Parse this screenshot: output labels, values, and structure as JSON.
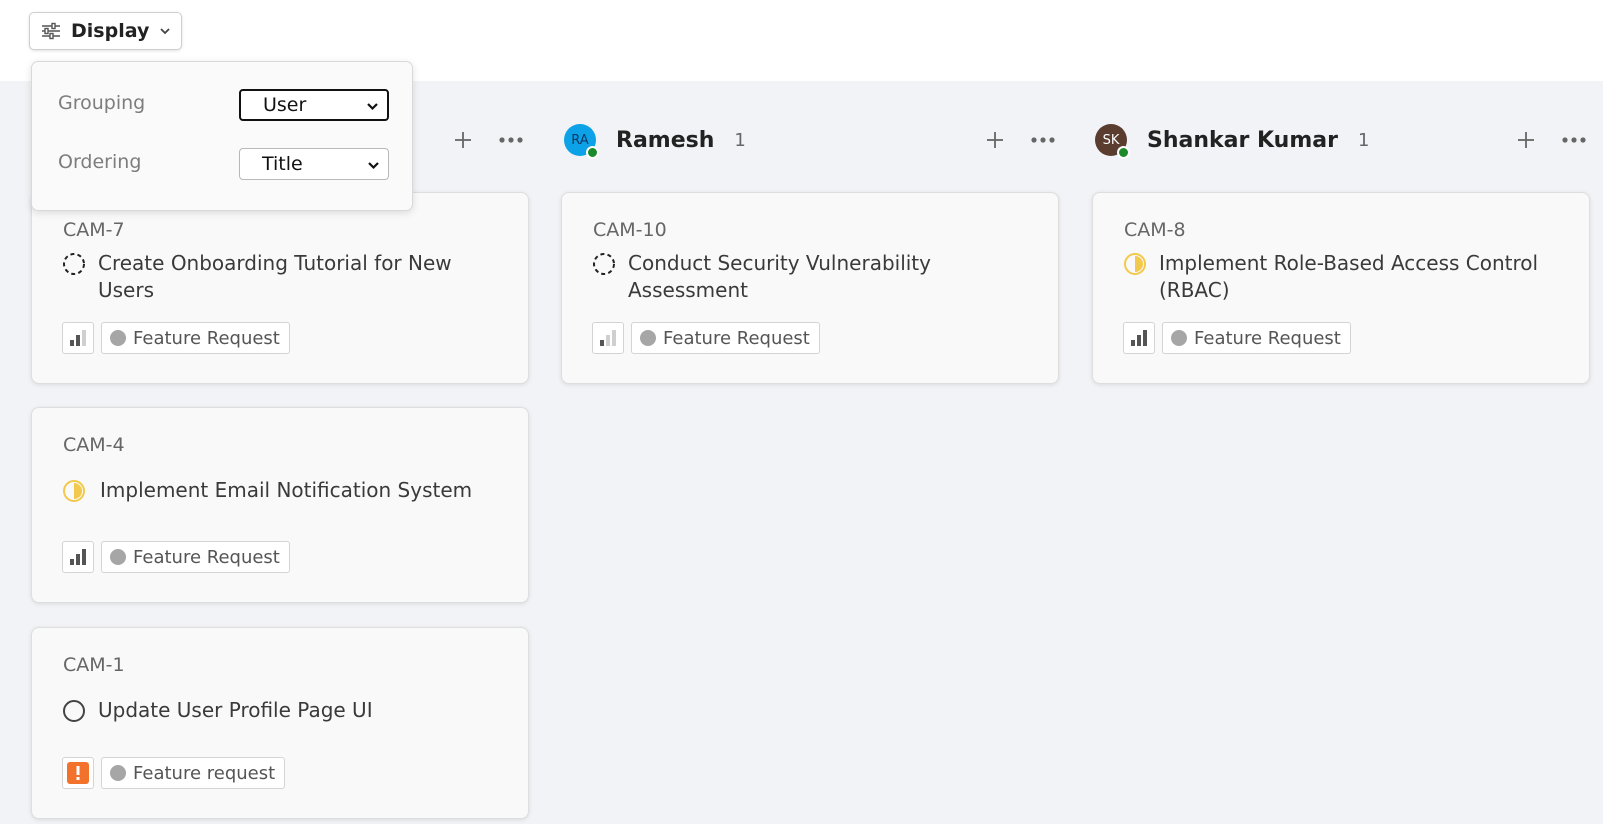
{
  "display": {
    "label": "Display",
    "icon": "sliders-icon",
    "chevron": "chevron-down-icon"
  },
  "display_menu": {
    "grouping_label": "Grouping",
    "grouping_value": "User",
    "ordering_label": "Ordering",
    "ordering_value": "Title"
  },
  "colors": {
    "board_bg": "#f2f3f6",
    "avatar_ramesh": "#0da2e7",
    "avatar_shankar": "#5a3d2f",
    "online": "#1a8a2a",
    "in_progress": "#f2c94c",
    "urgent": "#f2722c"
  },
  "columns": [
    {
      "name": "",
      "count": "",
      "cards": [
        {
          "id": "CAM-7",
          "title": "Create Onboarding Tutorial for New Users",
          "status": "backlog",
          "priority": "medium",
          "label": "Feature Request"
        },
        {
          "id": "CAM-4",
          "title": "Implement Email Notification System",
          "status": "in-progress",
          "priority": "high",
          "label": "Feature Request"
        },
        {
          "id": "CAM-1",
          "title": "Update User Profile Page UI",
          "status": "todo",
          "priority": "urgent",
          "label": "Feature request"
        }
      ]
    },
    {
      "name": "Ramesh",
      "initials": "RA",
      "count": "1",
      "cards": [
        {
          "id": "CAM-10",
          "title": "Conduct Security Vulnerability Assessment",
          "status": "backlog",
          "priority": "low",
          "label": "Feature Request"
        }
      ]
    },
    {
      "name": "Shankar Kumar",
      "initials": "SK",
      "count": "1",
      "cards": [
        {
          "id": "CAM-8",
          "title": "Implement Role-Based Access Control (RBAC)",
          "status": "in-progress",
          "priority": "high",
          "label": "Feature Request"
        }
      ]
    }
  ]
}
